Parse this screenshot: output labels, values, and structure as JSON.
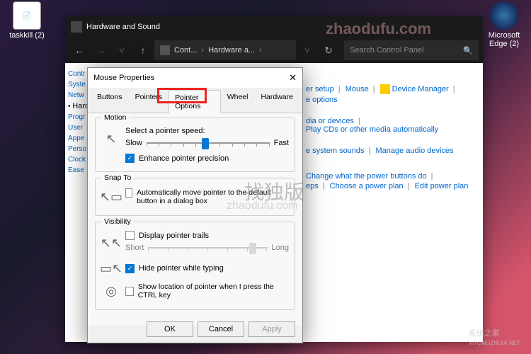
{
  "desktop": {
    "icon1": "taskkill (2)",
    "icon2": "Microsoft Edge (2)"
  },
  "controlPanel": {
    "title": "Hardware and Sound",
    "breadcrumb1": "Cont...",
    "breadcrumb2": "Hardware a...",
    "searchPlaceholder": "Search Control Panel",
    "side": {
      "i0": "Contr",
      "i1": "Syste",
      "i2": "Netw",
      "i3": "Hard",
      "i4": "Progr",
      "i5": "User",
      "i6": "Appe",
      "i7": "Perso",
      "i8": "Clock",
      "i9": "Ease"
    },
    "links": {
      "r1a": "er setup",
      "r1b": "Mouse",
      "r1c": "Device Manager",
      "r1d": "e options",
      "r2a": "dia or devices",
      "r2b": "Play CDs or other media automatically",
      "r3a": "e system sounds",
      "r3b": "Manage audio devices",
      "r4a": "Change what the power buttons do",
      "r4b": "eps",
      "r4c": "Choose a power plan",
      "r4d": "Edit power plan"
    }
  },
  "mouseProps": {
    "title": "Mouse Properties",
    "tabs": {
      "t0": "Buttons",
      "t1": "Pointers",
      "t2": "Pointer Options",
      "t3": "Wheel",
      "t4": "Hardware"
    },
    "motion": {
      "group": "Motion",
      "label": "Select a pointer speed:",
      "slow": "Slow",
      "fast": "Fast",
      "enhance": "Enhance pointer precision"
    },
    "snap": {
      "group": "Snap To",
      "label": "Automatically move pointer to the default button in a dialog box"
    },
    "vis": {
      "group": "Visibility",
      "trails": "Display pointer trails",
      "short": "Short",
      "long": "Long",
      "hide": "Hide pointer while typing",
      "ctrl": "Show location of pointer when I press the CTRL key"
    },
    "buttons": {
      "ok": "OK",
      "cancel": "Cancel",
      "apply": "Apply"
    }
  },
  "watermarks": {
    "w1": "zhaodufu.com",
    "w2": "找独版",
    "w3": "zhaodufu.com",
    "w4": "系统之家",
    "w5": "XITONGZHIJIA.NET"
  }
}
